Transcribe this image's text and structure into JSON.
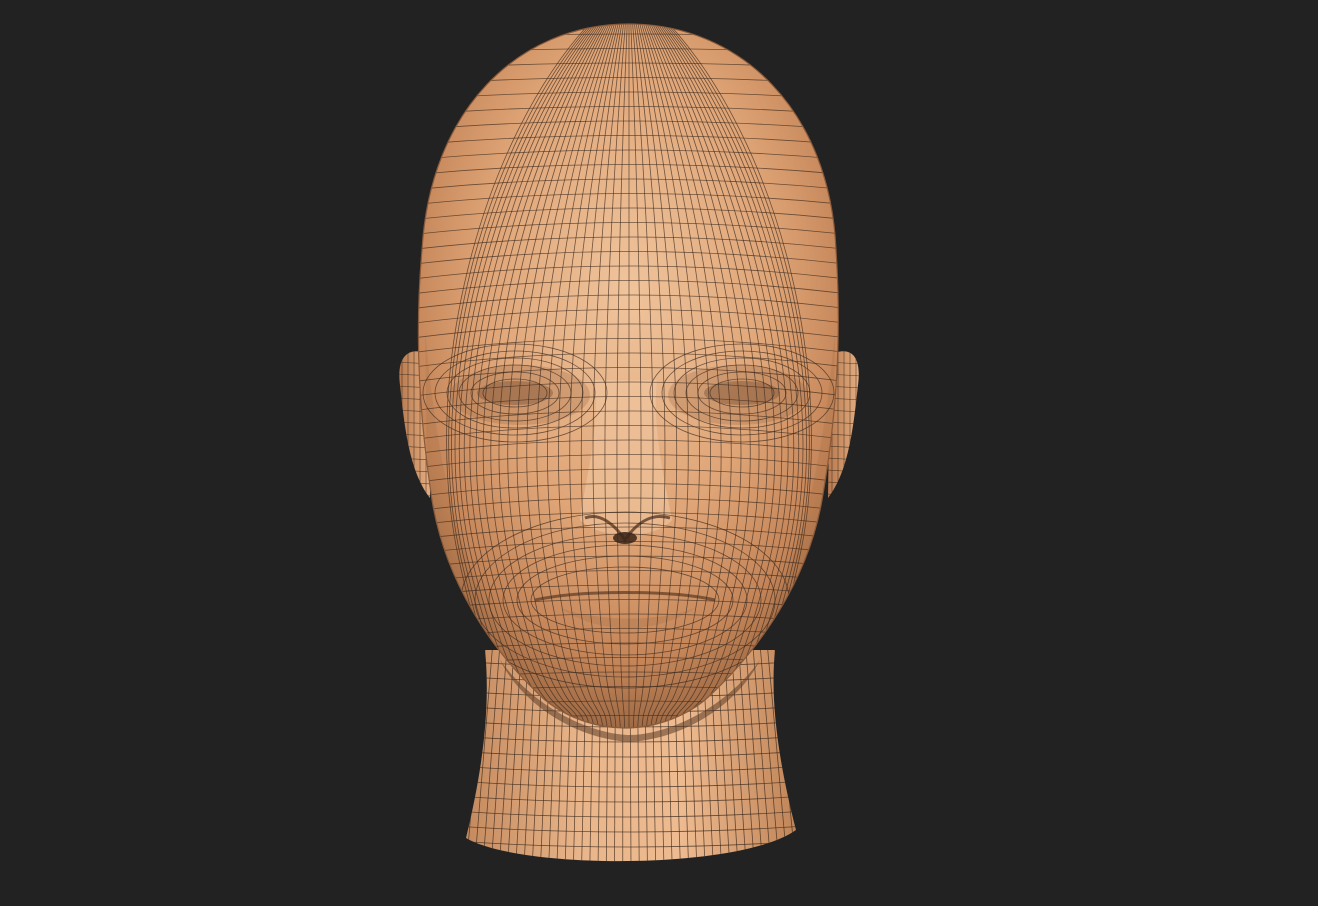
{
  "viewport": {
    "background_color": "#222222",
    "object": "head-mesh",
    "display_mode": "polyframe",
    "colors": {
      "skin_light": "#f0c49c",
      "skin_mid": "#d89c6e",
      "skin_dark": "#9e6a45",
      "wire": "#3b2a1e",
      "shadow": "#5a3a26"
    }
  }
}
